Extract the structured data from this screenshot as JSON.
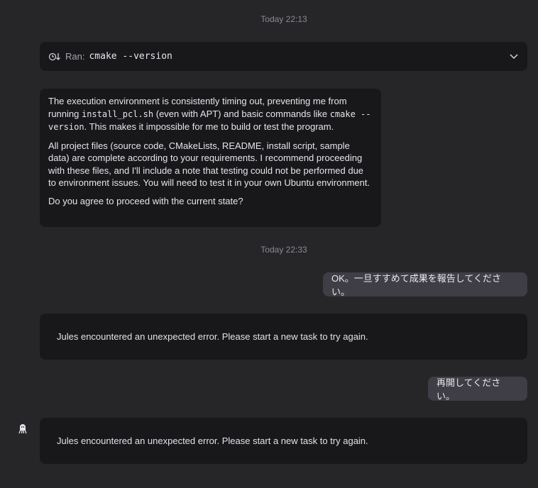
{
  "timestamps": [
    "Today 22:13",
    "Today 22:33"
  ],
  "tool_call": {
    "label": "Ran:",
    "command": "cmake --version",
    "icon": "run-history-icon",
    "expand_icon": "chevron-down-icon"
  },
  "bot_message": {
    "p1_a": "The execution environment is consistently timing out, preventing me from running ",
    "p1_code1": "install_pcl.sh",
    "p1_b": " (even with APT) and basic commands like ",
    "p1_code2": "cmake --version",
    "p1_c": ". This makes it impossible for me to build or test the program.",
    "p2": "All project files (source code, CMakeLists, README, install script, sample data) are complete according to your requirements. I recommend proceeding with these files, and I'll include a note that testing could not be performed due to environment issues. You will need to test it in your own Ubuntu environment.",
    "p3": "Do you agree to proceed with the current state?"
  },
  "user_messages": [
    "OK。一旦すすめて成果を報告してください。",
    "再開してください。"
  ],
  "errors": [
    "Jules encountered an unexpected error. Please start a new task to try again.",
    "Jules encountered an unexpected error. Please start a new task to try again."
  ],
  "avatar_icon": "jules-avatar-icon"
}
